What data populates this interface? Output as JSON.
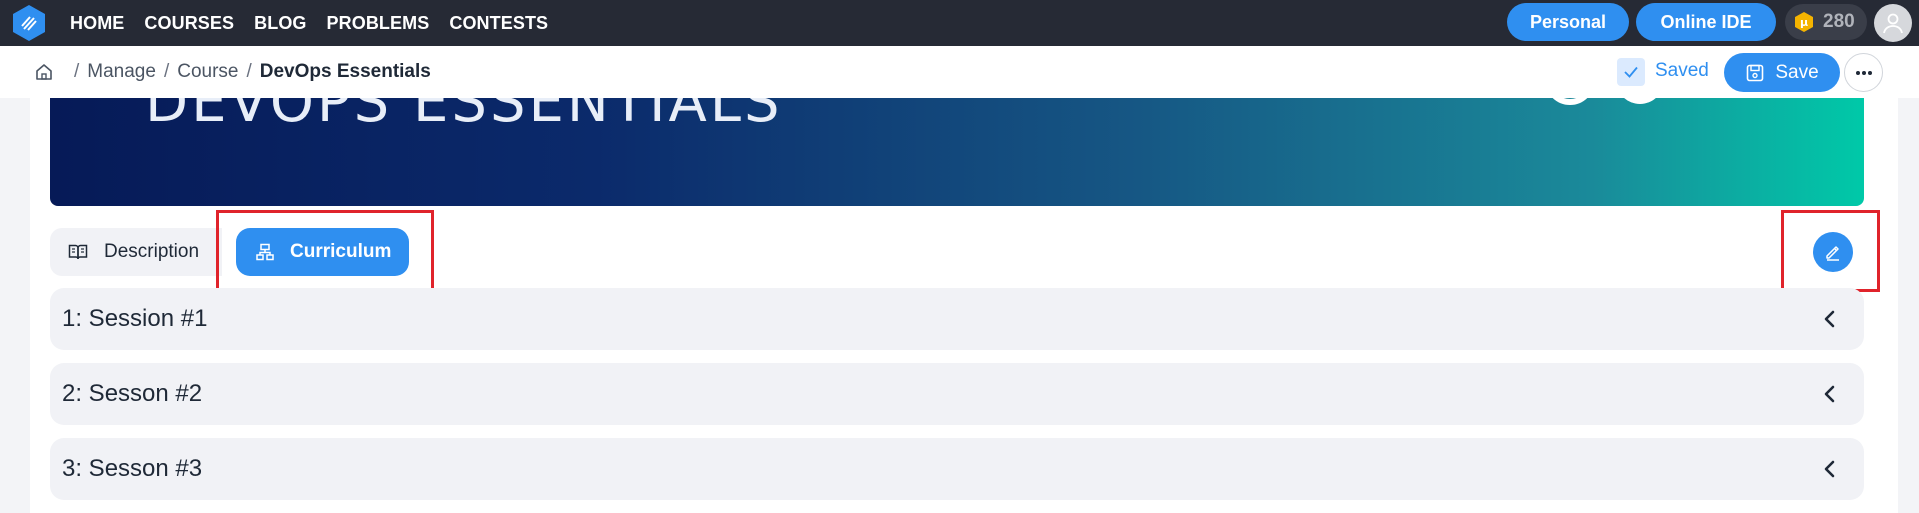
{
  "nav": {
    "links": [
      "HOME",
      "COURSES",
      "BLOG",
      "PROBLEMS",
      "CONTESTS"
    ],
    "personal": "Personal",
    "online_ide": "Online IDE",
    "coins": "280",
    "coin_symbol": "μ"
  },
  "breadcrumb": {
    "items": [
      "Manage",
      "Course"
    ],
    "current": "DevOps Essentials",
    "separator": "/"
  },
  "toolbar": {
    "saved_label": "Saved",
    "save_label": "Save"
  },
  "banner": {
    "title": "DEVOPS ESSENTIALS"
  },
  "tabs": {
    "description": "Description",
    "curriculum": "Curriculum"
  },
  "sessions": [
    {
      "label": "1: Session #1"
    },
    {
      "label": "2: Sesson #2"
    },
    {
      "label": "3: Sesson #3"
    }
  ],
  "colors": {
    "accent": "#2f8ff0",
    "navbar": "#262a35",
    "highlight": "#e0232b"
  }
}
